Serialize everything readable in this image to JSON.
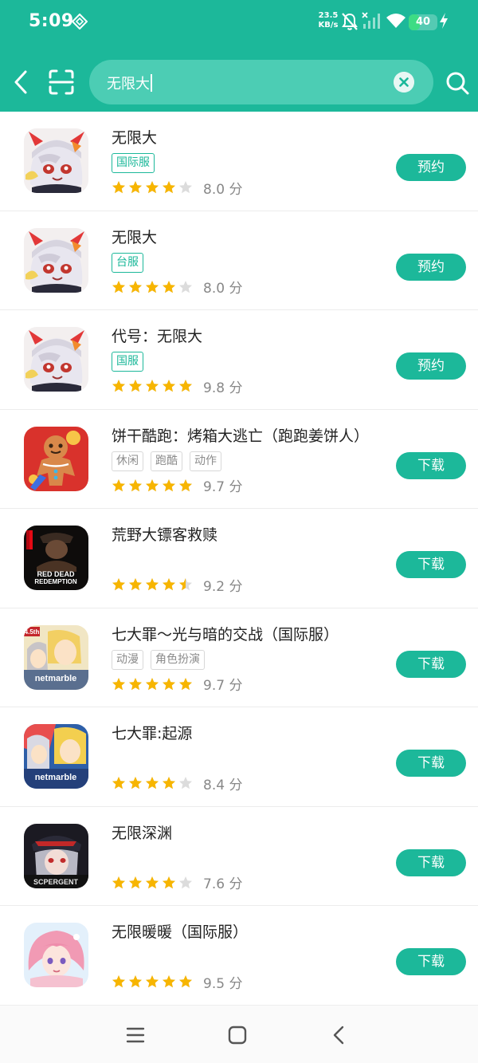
{
  "status_bar": {
    "time": "5:09",
    "net_speed_value": "23.5",
    "net_speed_unit": "KB/s",
    "battery_level": "40",
    "icons": [
      "app-logo-icon",
      "mute-bell-icon",
      "no-signal-icon",
      "wifi-icon",
      "battery-icon",
      "charging-icon"
    ]
  },
  "header": {
    "search_value": "无限大",
    "icons": [
      "back-arrow-icon",
      "scan-icon",
      "clear-icon",
      "search-icon"
    ]
  },
  "colors": {
    "accent": "#1cb89a",
    "search_box": "#4ccdb4",
    "star_filled": "#f7b500",
    "star_empty": "#dcdcdc",
    "region_tag": "#1cb89a",
    "genre_tag": "#8c8c8c"
  },
  "apps": [
    {
      "name": "无限大",
      "tags": [
        {
          "text": "国际服",
          "kind": "region"
        }
      ],
      "rating": 8.0,
      "score_text": "8.0 分",
      "stars_filled": 4,
      "action": "预约",
      "icon": "anime-girl-bunny-ears-icon"
    },
    {
      "name": "无限大",
      "tags": [
        {
          "text": "台服",
          "kind": "region"
        }
      ],
      "rating": 8.0,
      "score_text": "8.0 分",
      "stars_filled": 4,
      "action": "预约",
      "icon": "anime-girl-bunny-ears-icon"
    },
    {
      "name": "代号：无限大",
      "tags": [
        {
          "text": "国服",
          "kind": "region"
        }
      ],
      "rating": 9.8,
      "score_text": "9.8 分",
      "stars_filled": 5,
      "action": "预约",
      "icon": "anime-girl-bunny-ears-icon"
    },
    {
      "name": "饼干酷跑：烤箱大逃亡（跑跑姜饼人）",
      "tags": [
        {
          "text": "休闲",
          "kind": "genre"
        },
        {
          "text": "跑酷",
          "kind": "genre"
        },
        {
          "text": "动作",
          "kind": "genre"
        }
      ],
      "rating": 9.7,
      "score_text": "9.7 分",
      "stars_filled": 5,
      "action": "下载",
      "icon": "gingerbread-cookie-icon"
    },
    {
      "name": "荒野大镖客救赎",
      "tags": [],
      "rating": 9.2,
      "score_text": "9.2 分",
      "stars_filled": 4.5,
      "action": "下载",
      "icon": "red-dead-redemption-icon",
      "icon_text": [
        "RED DEAD",
        "REDEMPTION"
      ]
    },
    {
      "name": "七大罪～光与暗的交战（国际服）",
      "tags": [
        {
          "text": "动漫",
          "kind": "genre"
        },
        {
          "text": "角色扮演",
          "kind": "genre"
        }
      ],
      "rating": 9.7,
      "score_text": "9.7 分",
      "stars_filled": 5,
      "action": "下载",
      "icon": "seven-deadly-sins-grand-cross-icon",
      "icon_text": [
        "netmarble",
        "4.5th"
      ]
    },
    {
      "name": "七大罪:起源",
      "tags": [],
      "rating": 8.4,
      "score_text": "8.4 分",
      "stars_filled": 4,
      "action": "下载",
      "icon": "seven-deadly-sins-origin-icon",
      "icon_text": [
        "netmarble"
      ]
    },
    {
      "name": "无限深渊",
      "tags": [],
      "rating": 7.6,
      "score_text": "7.6 分",
      "stars_filled": 4,
      "action": "下载",
      "icon": "dark-anime-girl-icon",
      "icon_text": [
        "SCPERGENT"
      ]
    },
    {
      "name": "无限暖暖（国际服）",
      "tags": [],
      "rating": 9.5,
      "score_text": "9.5 分",
      "stars_filled": 5,
      "action": "下载",
      "icon": "pink-haired-girl-icon"
    }
  ],
  "nav_bar": {
    "icons": [
      "menu-icon",
      "home-icon",
      "back-icon"
    ]
  }
}
